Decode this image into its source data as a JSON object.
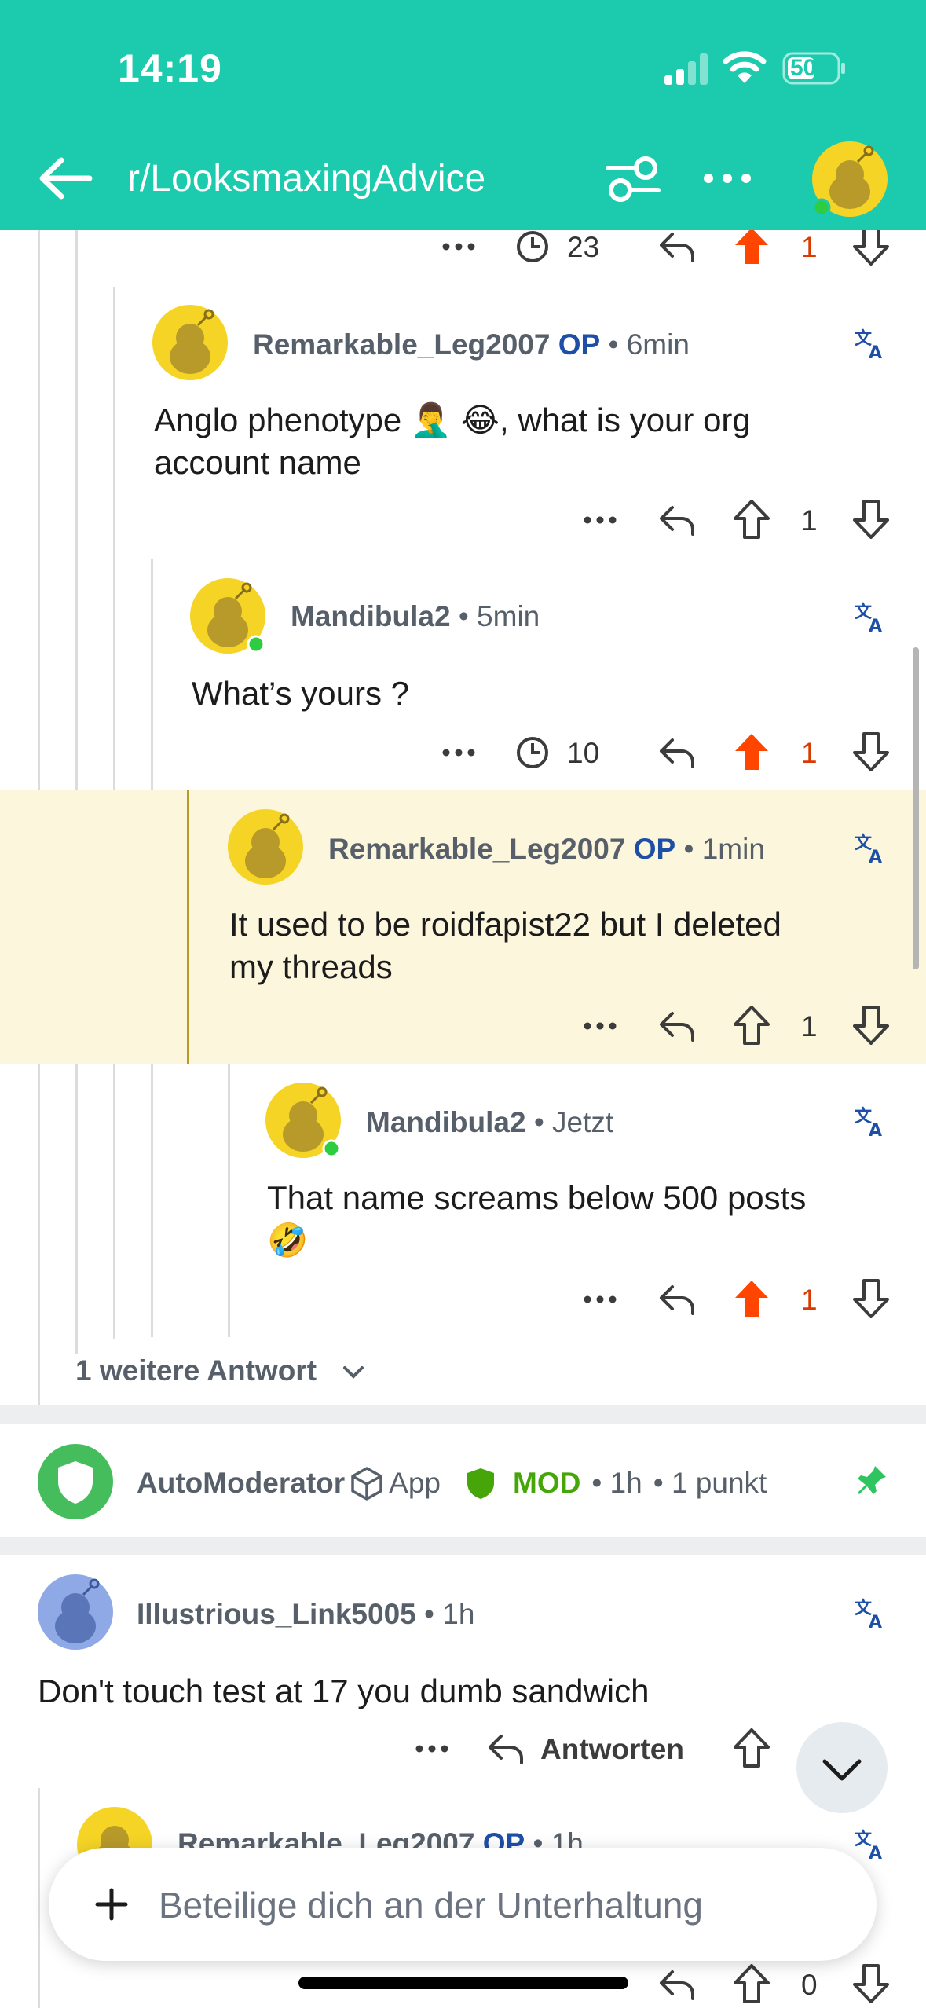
{
  "status_bar": {
    "time": "14:19",
    "battery": "50"
  },
  "header": {
    "subreddit": "r/LooksmaxingAdvice"
  },
  "top_actions": {
    "award_count": "23",
    "vote_count": "1"
  },
  "comments": [
    {
      "user": "Remarkable_Leg2007",
      "op": "OP",
      "time": "• 6min",
      "body_line1": "Anglo phenotype 🤦‍♂️ 😂, what is your org",
      "body_line2": "account name",
      "vote_count": "1"
    },
    {
      "user": "Mandibula2",
      "time": "• 5min",
      "body": "What’s yours ?",
      "award_count": "10",
      "vote_count": "1"
    },
    {
      "user": "Remarkable_Leg2007",
      "op": "OP",
      "time": "• 1min",
      "body_line1": "It used to be roidfapist22 but I deleted",
      "body_line2": "my threads",
      "vote_count": "1"
    },
    {
      "user": "Mandibula2",
      "time": "• Jetzt",
      "body_line1": "That name screams below 500 posts",
      "body_line2": "🤣",
      "vote_count": "1"
    }
  ],
  "more_replies": "1 weitere Antwort",
  "automod": {
    "user": "AutoModerator",
    "app": "App",
    "mod": "MOD",
    "time": "• 1h",
    "points": "• 1 punkt"
  },
  "thread2": {
    "user": "Illustrious_Link5005",
    "time": "• 1h",
    "body": "Don't touch test at 17 you dumb sandwich",
    "reply_label": "Antworten",
    "sub_user": "Remarkable_Leg2007",
    "sub_op": "OP",
    "sub_time": "• 1h",
    "bottom_vote": "0"
  },
  "compose": {
    "placeholder": "Beteilige dich an der Unterhaltung"
  },
  "colors": {
    "header": "#1ccaae",
    "upvote": "#ff4500",
    "op": "#1d4fa6",
    "mod": "#46a508",
    "highlight": "#fcf6dc"
  }
}
